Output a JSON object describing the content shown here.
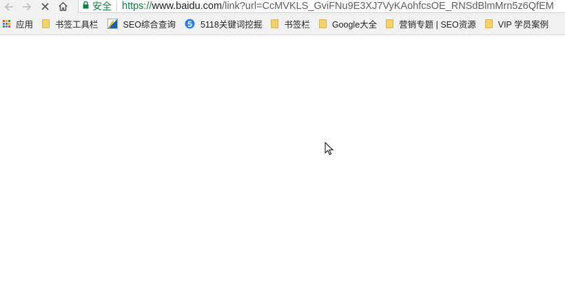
{
  "toolbar": {
    "secure_label": "安全",
    "url_scheme": "https://",
    "url_host": "www.baidu.com",
    "url_path": "/link?url=CcMVKLS_GviFNu9E3XJ7VyKAohfcsOE_RNSdBlmMrn5z6QfEM"
  },
  "bookmarks": {
    "items": [
      {
        "label": "应用",
        "icon": "apps-grid-icon"
      },
      {
        "label": "书签工具栏",
        "icon": "folder-icon"
      },
      {
        "label": "SEO综合查询",
        "icon": "seo-site-icon"
      },
      {
        "label": "5118关键词挖掘",
        "icon": "5118-site-icon"
      },
      {
        "label": "书签栏",
        "icon": "folder-icon"
      },
      {
        "label": "Google大全",
        "icon": "folder-icon"
      },
      {
        "label": "营销专题 | SEO资源",
        "icon": "folder-icon"
      },
      {
        "label": "VIP 学员案例",
        "icon": "folder-icon"
      }
    ]
  },
  "colors": {
    "secure_green": "#0b8043",
    "toolbar_bg": "#f2f2f2",
    "folder_yellow": "#f4d26a"
  }
}
